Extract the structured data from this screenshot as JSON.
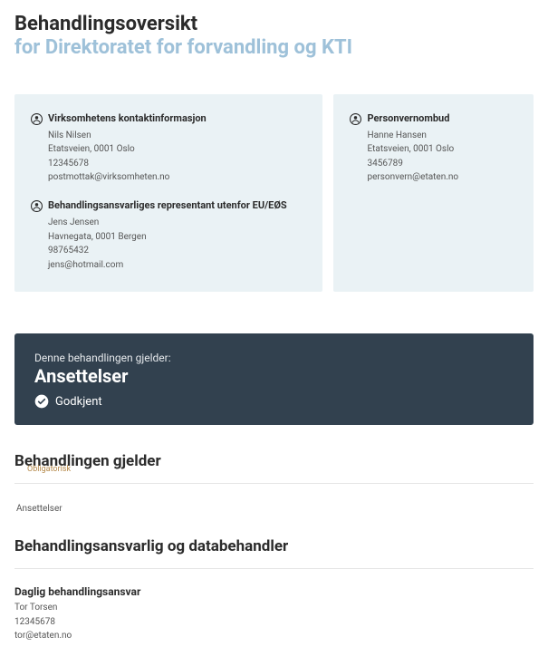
{
  "header": {
    "title": "Behandlingsoversikt",
    "subtitle": "for Direktoratet for forvandling og KTI"
  },
  "contact_card": {
    "sections": [
      {
        "heading": "Virksomhetens kontaktinformasjon",
        "lines": [
          "Nils Nilsen",
          "Etatsveien, 0001 Oslo",
          "12345678",
          "postmottak@virksomheten.no"
        ]
      },
      {
        "heading": "Behandlingsansvarliges representant utenfor EU/EØS",
        "lines": [
          "Jens Jensen",
          "Havnegata, 0001 Bergen",
          "98765432",
          "jens@hotmail.com"
        ]
      }
    ]
  },
  "dpo_card": {
    "heading": "Personvernombud",
    "lines": [
      "Hanne Hansen",
      "Etatsveien, 0001 Oslo",
      "3456789",
      "personvern@etaten.no"
    ]
  },
  "treatment": {
    "label": "Denne behandlingen gjelder:",
    "name": "Ansettelser",
    "status": "Godkjent"
  },
  "section_applies": {
    "title": "Behandlingen gjelder",
    "tag": "Obligatorisk",
    "value": "Ansettelser"
  },
  "section_responsible": {
    "title": "Behandlingsansvarlig og databehandler",
    "daily": {
      "heading": "Daglig behandlingsansvar",
      "lines": [
        "Tor Torsen",
        "12345678",
        "tor@etaten.no"
      ]
    }
  }
}
